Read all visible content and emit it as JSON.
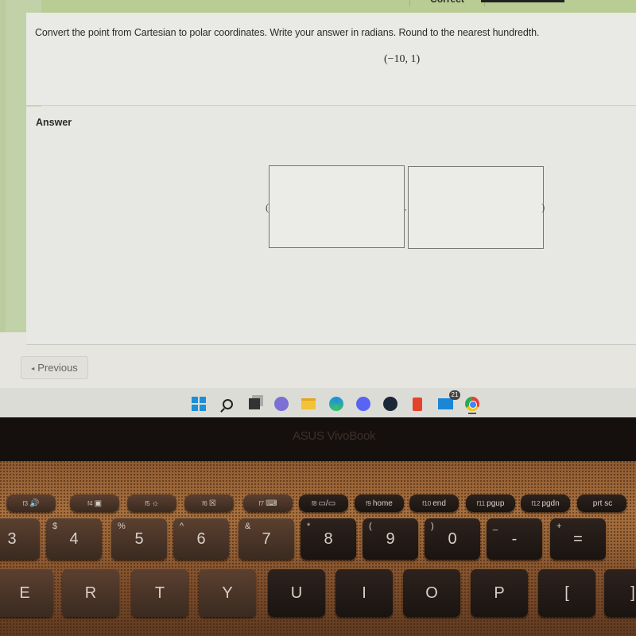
{
  "top_strip": {
    "tab_label": "Correct"
  },
  "question": {
    "prompt": "Convert the point from Cartesian to polar coordinates. Write your answer in radians. Round to the nearest hundredth.",
    "point": "(−10, 1)"
  },
  "answer": {
    "label": "Answer",
    "open_paren": "(",
    "separator": ",",
    "close_paren": ")",
    "r_value": "",
    "theta_value": ""
  },
  "navigation": {
    "previous_arrow": "◂",
    "previous_label": "Previous"
  },
  "taskbar": {
    "icons": [
      "windows-start",
      "search",
      "task-view",
      "teams-meet",
      "file-explorer",
      "edge",
      "discord",
      "steam",
      "office",
      "mail",
      "chrome"
    ],
    "mail_badge": "21"
  },
  "laptop": {
    "brand": "ASUS VivoBook"
  },
  "keyboard": {
    "function_row": [
      {
        "fn": "f3",
        "label": "🔊"
      },
      {
        "fn": "f4",
        "label": "▣"
      },
      {
        "fn": "f5",
        "label": "☼"
      },
      {
        "fn": "f6",
        "label": "☒"
      },
      {
        "fn": "f7",
        "label": "⌨"
      },
      {
        "fn": "f8",
        "label": "▭/▭"
      },
      {
        "fn": "f9",
        "label": "home"
      },
      {
        "fn": "f10",
        "label": "end"
      },
      {
        "fn": "f11",
        "label": "pgup"
      },
      {
        "fn": "f12",
        "label": "pgdn"
      },
      {
        "fn": "",
        "label": "prt sc"
      }
    ],
    "number_row": [
      {
        "main": "3",
        "shift": "#"
      },
      {
        "main": "4",
        "shift": "$"
      },
      {
        "main": "5",
        "shift": "%"
      },
      {
        "main": "6",
        "shift": "^"
      },
      {
        "main": "7",
        "shift": "&"
      },
      {
        "main": "8",
        "shift": "*"
      },
      {
        "main": "9",
        "shift": "("
      },
      {
        "main": "0",
        "shift": ")"
      },
      {
        "main": "-",
        "shift": "_"
      },
      {
        "main": "=",
        "shift": "+"
      }
    ],
    "letter_row": [
      "E",
      "R",
      "T",
      "Y",
      "U",
      "I",
      "O",
      "P",
      "[",
      "]"
    ]
  }
}
